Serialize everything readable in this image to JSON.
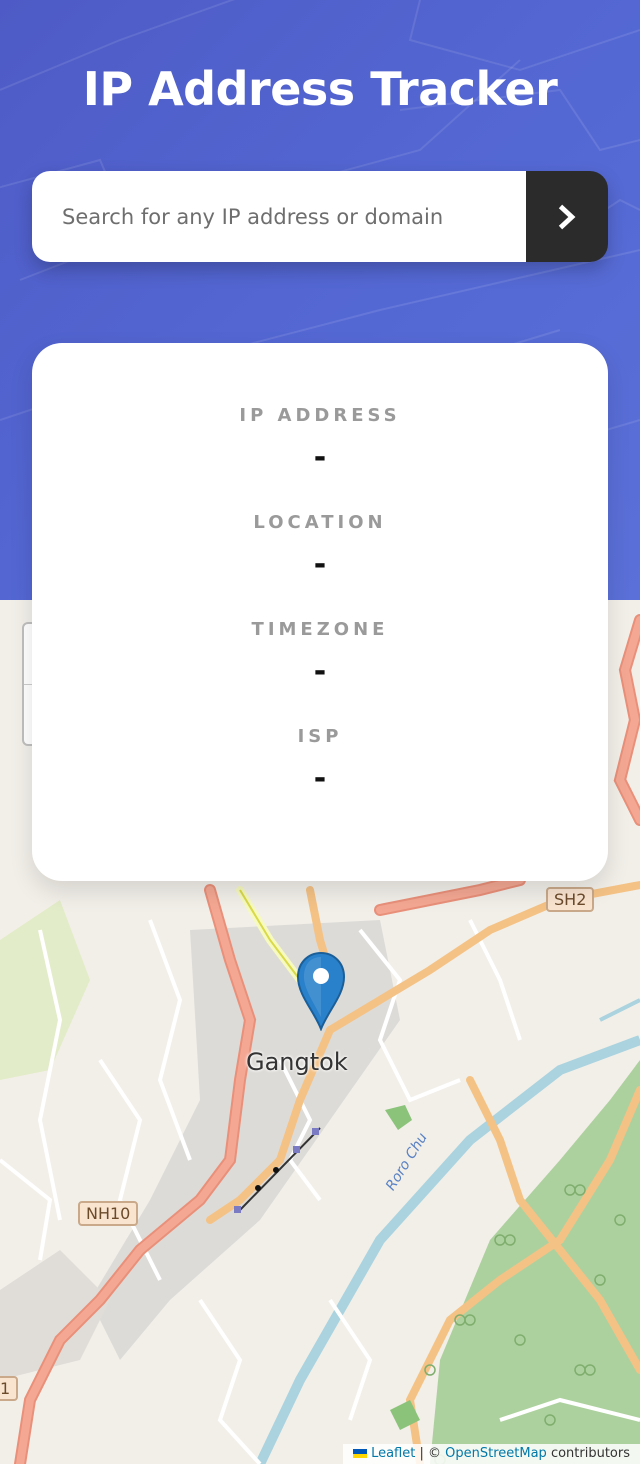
{
  "header": {
    "title": "IP Address Tracker"
  },
  "search": {
    "placeholder": "Search for any IP address or domain",
    "value": "",
    "button_icon": "chevron-right-icon"
  },
  "info": {
    "ip_label": "IP ADDRESS",
    "ip_value": "-",
    "location_label": "LOCATION",
    "location_value": "-",
    "timezone_label": "TIMEZONE",
    "timezone_value": "-",
    "isp_label": "ISP",
    "isp_value": "-"
  },
  "map": {
    "city_label": "Gangtok",
    "river_label": "Roro Chu",
    "road_shields": [
      "SH2",
      "NH10",
      "1"
    ],
    "marker_icon": "map-pin-icon",
    "attribution": {
      "leaflet": "Leaflet",
      "separator": "| ©",
      "osm": "OpenStreetMap",
      "suffix": "contributors"
    }
  },
  "colors": {
    "header_bg": "#5064cc",
    "card_bg": "#ffffff",
    "button_bg": "#2b2b2b",
    "label_gray": "#9a9a9a",
    "value_black": "#111111"
  }
}
